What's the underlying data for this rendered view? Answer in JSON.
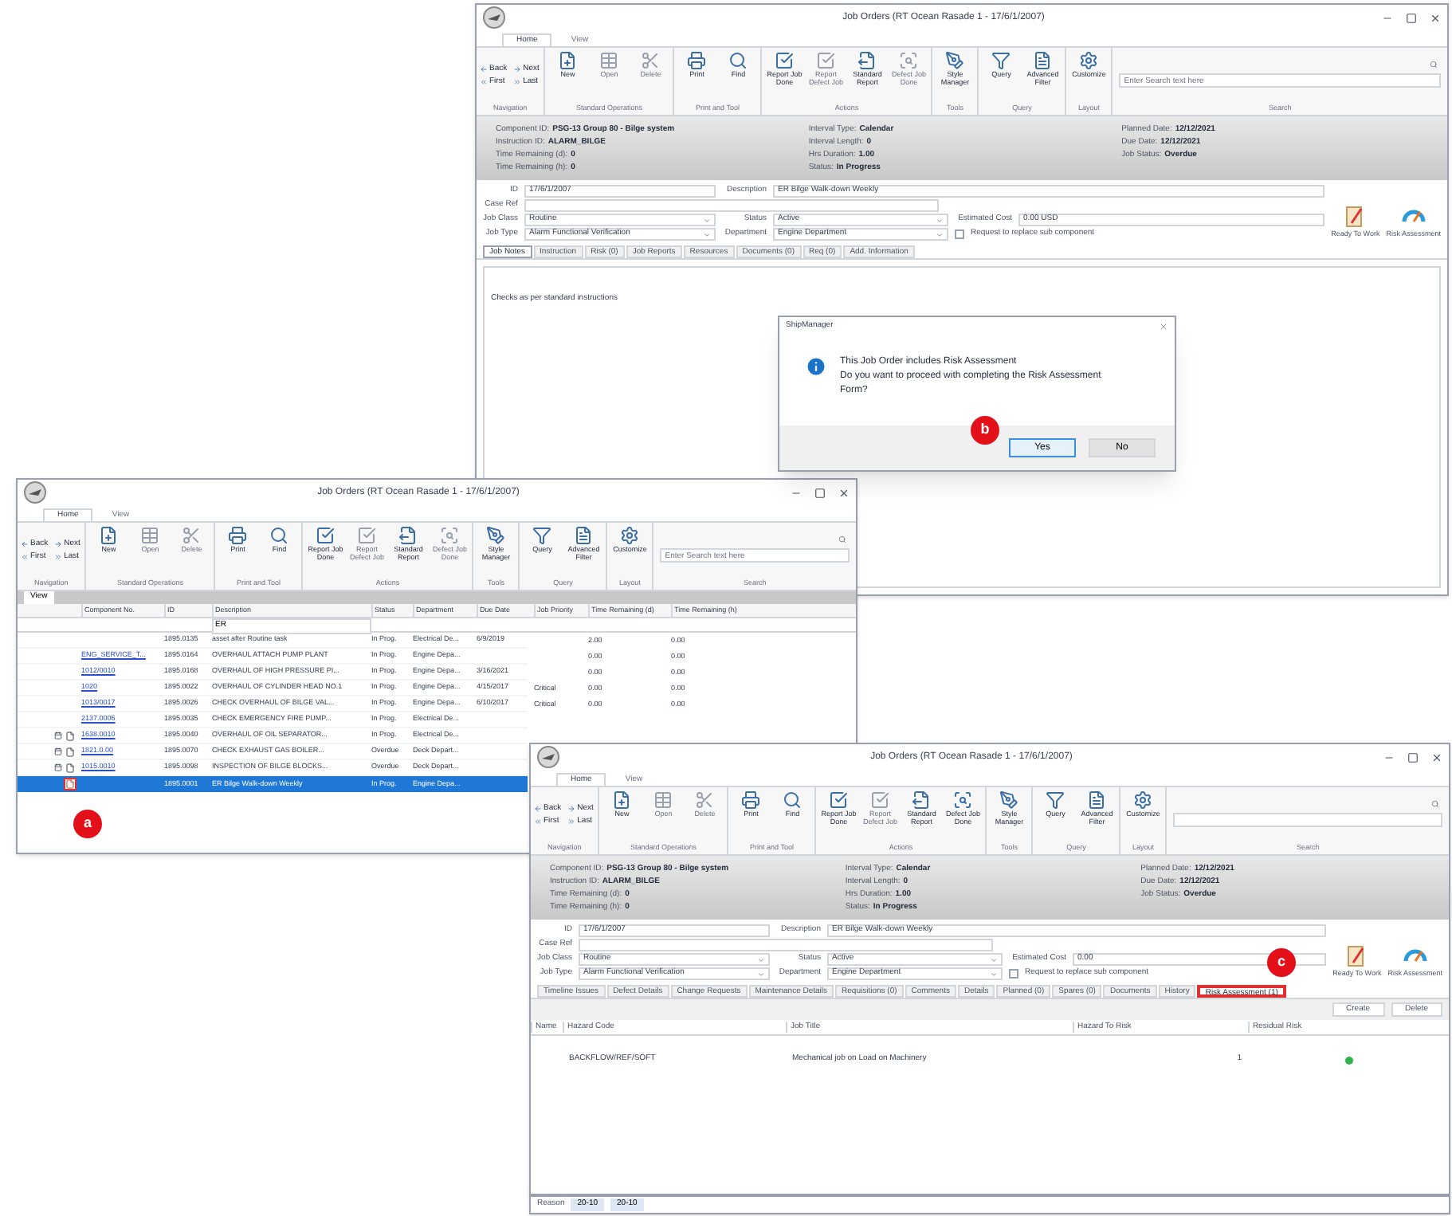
{
  "top_window": {
    "title": "Job Orders (RT Ocean Rasade 1 - 17/6/1/2007)",
    "ribbon": {
      "tabs": [
        {
          "label": "Home",
          "selected": true
        },
        {
          "label": "View",
          "selected": false
        }
      ],
      "groups": [
        {
          "label": "Navigation",
          "buttons": [
            {
              "label": "Back",
              "disabled": false
            },
            {
              "label": "Next",
              "disabled": false
            },
            {
              "label": "First",
              "disabled": false
            },
            {
              "label": "Last",
              "disabled": false
            }
          ]
        },
        {
          "label": "Standard Operations",
          "buttons": [
            {
              "label": "New",
              "disabled": false
            },
            {
              "label": "Open",
              "disabled": true
            },
            {
              "label": "Delete",
              "disabled": true
            }
          ]
        },
        {
          "label": "Print and Tool",
          "buttons": [
            {
              "label": "Print",
              "disabled": false
            },
            {
              "label": "Find",
              "disabled": false
            }
          ]
        },
        {
          "label": "Actions",
          "buttons": [
            {
              "label": "Report Job Done",
              "disabled": false
            },
            {
              "label": "Report Defect Job",
              "disabled": true
            },
            {
              "label": "Standard Report",
              "disabled": false
            },
            {
              "label": "Defect Job Done",
              "disabled": true
            }
          ]
        },
        {
          "label": "Tools",
          "buttons": [
            {
              "label": "Style Manager",
              "disabled": false
            }
          ]
        },
        {
          "label": "Query",
          "buttons": [
            {
              "label": "Query",
              "disabled": false
            },
            {
              "label": "Advanced Filter",
              "disabled": false
            }
          ]
        },
        {
          "label": "Layout",
          "buttons": [
            {
              "label": "Customize",
              "disabled": false
            }
          ]
        }
      ],
      "search": {
        "label": "Search",
        "placeholder": "Enter Search text here"
      }
    },
    "info": [
      [
        {
          "label": "Component ID:",
          "value": "PSG-13 Group 80 - Bilge system"
        },
        {
          "label": "Instruction ID:",
          "value": "ALARM_BILGE"
        },
        {
          "label": "Time Remaining (d):",
          "value": "0"
        },
        {
          "label": "Time Remaining (h):",
          "value": "0"
        }
      ],
      [
        {
          "label": "Interval Type:",
          "value": "Calendar"
        },
        {
          "label": "Interval Length:",
          "value": "0"
        },
        {
          "label": "Hrs Duration:",
          "value": "1.00"
        },
        {
          "label": "Status:",
          "value": "In Progress"
        }
      ],
      [
        {
          "label": "Planned Date:",
          "value": "12/12/2021"
        },
        {
          "label": "Due Date:",
          "value": "12/12/2021"
        },
        {
          "label": "Job Status:",
          "value": "Overdue"
        }
      ]
    ],
    "form": {
      "id_label": "ID",
      "id_value": "17/6/1/2007",
      "description_label": "Description",
      "description_value": "ER Bilge Walk-down Weekly",
      "case_label": "Case Ref",
      "class_label": "Job Class",
      "class_value": "Routine",
      "type_label": "Job Type",
      "type_value": "Alarm Functional Verification",
      "status_label": "Status",
      "status_value": "Active",
      "department_label": "Department",
      "department_value": "Engine Department",
      "cost_label": "Estimated Cost",
      "cost_value": "0.00 USD",
      "check_label": "Request to replace sub component",
      "checked": false
    },
    "actions": [
      "Ready To Work",
      "Risk Assessment"
    ],
    "tabs": [
      {
        "label": "Job Notes",
        "selected": true
      },
      {
        "label": "Instruction",
        "selected": false
      },
      {
        "label": "Risk (0)",
        "selected": false
      },
      {
        "label": "Job Reports",
        "selected": false
      },
      {
        "label": "Resources",
        "selected": false
      },
      {
        "label": "Documents (0)",
        "selected": false
      },
      {
        "label": "Req (0)",
        "selected": false
      },
      {
        "label": "Add. Information",
        "selected": false
      }
    ],
    "note": "Checks as per standard instructions"
  },
  "dialog": {
    "title": "ShipManager",
    "message_1": "This Job Order includes Risk Assessment",
    "message_2": "Do you want to proceed with completing the Risk Assessment Form?",
    "buttons": [
      {
        "label": "Yes",
        "selected": true
      },
      {
        "label": "No",
        "selected": false
      }
    ]
  },
  "left_window": {
    "title": "Job Orders (RT Ocean Rasade 1 - 17/6/1/2007)",
    "ribbon": {
      "tabs": [
        {
          "label": "Home",
          "selected": true
        },
        {
          "label": "View",
          "selected": false
        }
      ],
      "groups": [
        {
          "label": "Navigation",
          "buttons": [
            {
              "label": "Back",
              "disabled": false
            },
            {
              "label": "Next",
              "disabled": false
            },
            {
              "label": "First",
              "disabled": false
            },
            {
              "label": "Last",
              "disabled": false
            }
          ]
        },
        {
          "label": "Standard Operations",
          "buttons": [
            {
              "label": "New",
              "disabled": false
            },
            {
              "label": "Open",
              "disabled": true
            },
            {
              "label": "Delete",
              "disabled": true
            }
          ]
        },
        {
          "label": "Print and Tool",
          "buttons": [
            {
              "label": "Print",
              "disabled": false
            },
            {
              "label": "Find",
              "disabled": false
            }
          ]
        },
        {
          "label": "Actions",
          "buttons": [
            {
              "label": "Report Job Done",
              "disabled": false
            },
            {
              "label": "Report Defect Job",
              "disabled": true
            },
            {
              "label": "Standard Report",
              "disabled": false
            },
            {
              "label": "Defect Job Done",
              "disabled": true
            }
          ]
        },
        {
          "label": "Tools",
          "buttons": [
            {
              "label": "Style Manager",
              "disabled": false
            }
          ]
        },
        {
          "label": "Query",
          "buttons": [
            {
              "label": "Query",
              "disabled": false
            },
            {
              "label": "Advanced Filter",
              "disabled": false
            }
          ]
        },
        {
          "label": "Layout",
          "buttons": [
            {
              "label": "Customize",
              "disabled": false
            }
          ]
        }
      ],
      "search": {
        "label": "Search",
        "placeholder": "Enter Search text here"
      }
    },
    "view_label": "View",
    "columns": [
      "Component No.",
      "ID",
      "Description",
      "Status",
      "Department",
      "Due Date",
      "Job Priority",
      "Time Remaining (d)",
      "Time Remaining (h)"
    ],
    "filter": "ER",
    "rows": [
      {
        "component": "",
        "id": "1895.0135",
        "description": "asset after Routine task",
        "status": "In Prog.",
        "department": "Electrical De...",
        "due": "6/9/2019",
        "priority": "",
        "rem_d": "2.00",
        "rem_h": "0.00",
        "attachment": false,
        "selected": false
      },
      {
        "component": "ENG_SERVICE_T...",
        "id": "1895.0164",
        "description": "OVERHAUL ATTACH PUMP PLANT",
        "status": "In Prog.",
        "department": "Engine Depa...",
        "due": "",
        "priority": "",
        "rem_d": "0.00",
        "rem_h": "0.00",
        "attachment": false,
        "selected": false
      },
      {
        "component": "1012/0010",
        "id": "1895.0168",
        "description": "OVERHAUL OF HIGH PRESSURE PI...",
        "status": "In Prog.",
        "department": "Engine Depa...",
        "due": "3/16/2021",
        "priority": "",
        "rem_d": "0.00",
        "rem_h": "0.00",
        "attachment": false,
        "selected": false
      },
      {
        "component": "1020",
        "id": "1895.0022",
        "description": "OVERHAUL OF CYLINDER HEAD NO.1",
        "status": "In Prog.",
        "department": "Engine Depa...",
        "due": "4/15/2017",
        "priority": "Critical",
        "rem_d": "0.00",
        "rem_h": "0.00",
        "attachment": false,
        "selected": false
      },
      {
        "component": "1013/0017",
        "id": "1895.0026",
        "description": "CHECK OVERHAUL OF BILGE VAL...",
        "status": "In Prog.",
        "department": "Engine Depa...",
        "due": "6/10/2017",
        "priority": "Critical",
        "rem_d": "0.00",
        "rem_h": "0.00",
        "attachment": false,
        "selected": false
      },
      {
        "component": "2137.0006",
        "id": "1895.0035",
        "description": "CHECK EMERGENCY FIRE PUMP...",
        "status": "In Prog.",
        "department": "Electrical De...",
        "due": "",
        "priority": "",
        "rem_d": "",
        "rem_h": "",
        "attachment": false,
        "selected": false
      },
      {
        "component": "1638.0010",
        "id": "1895.0040",
        "description": "OVERHAUL OF OIL SEPARATOR...",
        "status": "In Prog.",
        "department": "Electrical De...",
        "due": "",
        "priority": "",
        "rem_d": "",
        "rem_h": "",
        "attachment": true,
        "selected": false
      },
      {
        "component": "1821.0.00",
        "id": "1895.0070",
        "description": "CHECK EXHAUST GAS BOILER...",
        "status": "Overdue",
        "department": "Deck Depart...",
        "due": "",
        "priority": "",
        "rem_d": "",
        "rem_h": "",
        "attachment": true,
        "selected": false
      },
      {
        "component": "1015.0010",
        "id": "1895.0098",
        "description": "INSPECTION OF BILGE BLOCKS...",
        "status": "Overdue",
        "department": "Deck Depart...",
        "due": "",
        "priority": "",
        "rem_d": "",
        "rem_h": "",
        "attachment": true,
        "selected": false
      },
      {
        "component": "",
        "id": "1895.0001",
        "description": "ER Bilge Walk-down Weekly",
        "status": "In Prog.",
        "department": "Engine Depa...",
        "due": "",
        "priority": "",
        "rem_d": "",
        "rem_h": "",
        "attachment": true,
        "selected": true
      }
    ]
  },
  "bottom_window": {
    "title": "Job Orders (RT Ocean Rasade 1 - 17/6/1/2007)",
    "ribbon": {
      "tabs": [
        {
          "label": "Home",
          "selected": true
        },
        {
          "label": "View",
          "selected": false
        }
      ],
      "groups": [
        {
          "label": "Navigation",
          "buttons": [
            {
              "label": "Back",
              "disabled": false
            },
            {
              "label": "Next",
              "disabled": false
            },
            {
              "label": "First",
              "disabled": false
            },
            {
              "label": "Last",
              "disabled": false
            }
          ]
        },
        {
          "label": "Standard Operations",
          "buttons": [
            {
              "label": "New",
              "disabled": false
            },
            {
              "label": "Open",
              "disabled": true
            },
            {
              "label": "Delete",
              "disabled": true
            }
          ]
        },
        {
          "label": "Print and Tool",
          "buttons": [
            {
              "label": "Print",
              "disabled": false
            },
            {
              "label": "Find",
              "disabled": false
            }
          ]
        },
        {
          "label": "Actions",
          "buttons": [
            {
              "label": "Report Job Done",
              "disabled": false
            },
            {
              "label": "Report Defect Job",
              "disabled": true
            },
            {
              "label": "Standard Report",
              "disabled": false
            },
            {
              "label": "Defect Job Done",
              "disabled": false
            }
          ]
        },
        {
          "label": "Tools",
          "buttons": [
            {
              "label": "Style Manager",
              "disabled": false
            }
          ]
        },
        {
          "label": "Query",
          "buttons": [
            {
              "label": "Query",
              "disabled": false
            },
            {
              "label": "Advanced Filter",
              "disabled": false
            }
          ]
        },
        {
          "label": "Layout",
          "buttons": [
            {
              "label": "Customize",
              "disabled": false
            }
          ]
        }
      ],
      "search": {
        "label": "Search"
      }
    },
    "info": [
      [
        {
          "label": "Component ID:",
          "value": "PSG-13 Group 80 - Bilge system"
        },
        {
          "label": "Instruction ID:",
          "value": "ALARM_BILGE"
        },
        {
          "label": "Time Remaining (d):",
          "value": "0"
        },
        {
          "label": "Time Remaining (h):",
          "value": "0"
        }
      ],
      [
        {
          "label": "Interval Type:",
          "value": "Calendar"
        },
        {
          "label": "Interval Length:",
          "value": "0"
        },
        {
          "label": "Hrs Duration:",
          "value": "1.00"
        },
        {
          "label": "Status:",
          "value": "In Progress"
        }
      ],
      [
        {
          "label": "Planned Date:",
          "value": "12/12/2021"
        },
        {
          "label": "Due Date:",
          "value": "12/12/2021"
        },
        {
          "label": "Job Status:",
          "value": "Overdue"
        }
      ]
    ],
    "form": {
      "id_label": "ID",
      "id_value": "17/6/1/2007",
      "description_label": "Description",
      "description_value": "ER Bilge Walk-down Weekly",
      "case_label": "Case Ref",
      "class_label": "Job Class",
      "class_value": "Routine",
      "type_label": "Job Type",
      "type_value": "Alarm Functional Verification",
      "status_label": "Status",
      "status_value": "Active",
      "department_label": "Department",
      "department_value": "Engine Department",
      "cost_label": "Estimated Cost",
      "cost_value": "0.00",
      "check_label": "Request to replace sub component",
      "checked": false
    },
    "actions": [
      "Ready To Work",
      "Risk Assessment"
    ],
    "tabs": [
      {
        "label": "Timeline Issues",
        "selected": false
      },
      {
        "label": "Defect Details",
        "selected": false
      },
      {
        "label": "Change Requests",
        "selected": false
      },
      {
        "label": "Maintenance Details",
        "selected": false
      },
      {
        "label": "Requisitions (0)",
        "selected": false
      },
      {
        "label": "Comments",
        "selected": false
      },
      {
        "label": "Details",
        "selected": false
      },
      {
        "label": "Planned (0)",
        "selected": false
      },
      {
        "label": "Spares (0)",
        "selected": false
      },
      {
        "label": "Documents",
        "selected": false
      },
      {
        "label": "History",
        "selected": false
      },
      {
        "label": "Risk Assessment (1)",
        "selected": true
      }
    ],
    "toolbar": [
      "Create",
      "Delete"
    ],
    "columns": [
      "Name",
      "Hazard Code",
      "Job Title",
      "Hazard To Risk",
      "Residual Risk"
    ],
    "rows": [
      {
        "name": "",
        "code": "BACKFLOW/REF/SOFT",
        "title": "Mechanical job on Load on Machinery",
        "hazard": "1",
        "color": "#2db34a"
      }
    ],
    "footer": {
      "label": "Reason",
      "value_1": "20-10",
      "value_2": "20-10"
    }
  },
  "badges": [
    {
      "letter": "a"
    },
    {
      "letter": "b"
    },
    {
      "letter": "c"
    }
  ]
}
